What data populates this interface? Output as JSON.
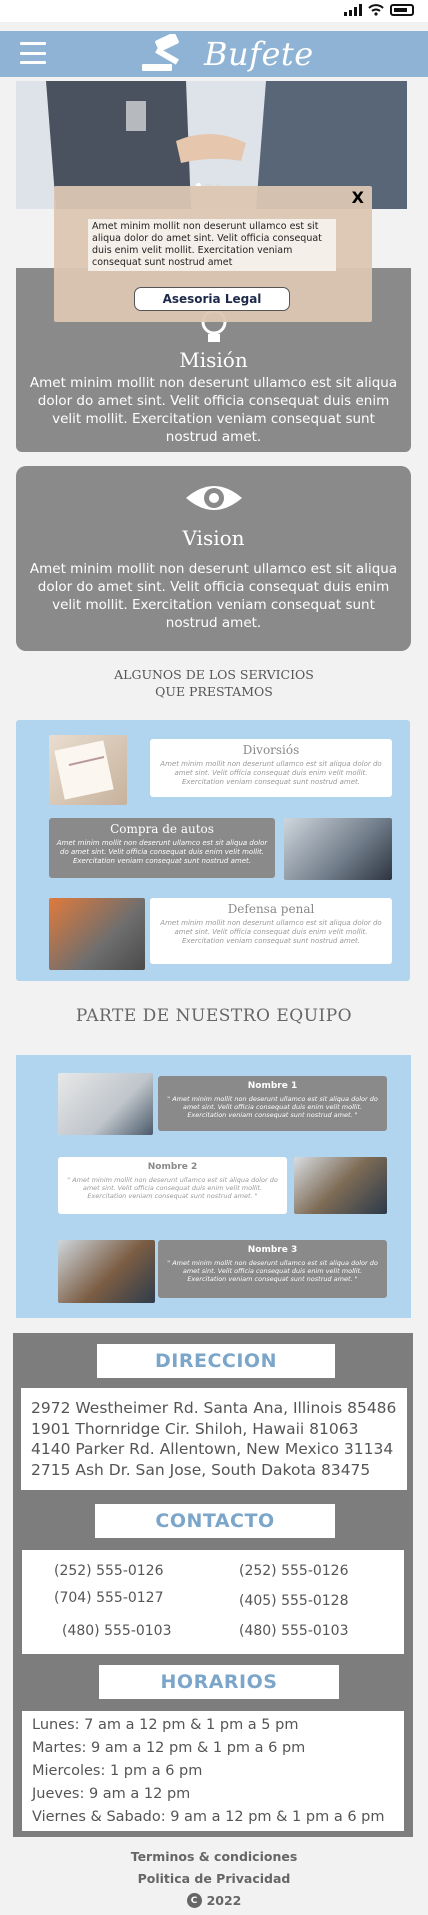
{
  "header": {
    "brand": "Bufete",
    "menu_icon": "hamburger-icon",
    "logo_icon": "gavel-icon"
  },
  "modal": {
    "close_label": "X",
    "text": "Amet minim mollit non deserunt ullamco est sit aliqua dolor do amet sint. Velit officia consequat duis enim velit mollit. Exercitation veniam consequat sunt nostrud amet",
    "button_label": "Asesoria Legal"
  },
  "mision": {
    "title": "Misión",
    "text": "Amet minim mollit non deserunt ullamco est sit aliqua dolor do amet sint. Velit officia consequat duis enim velit mollit. Exercitation veniam consequat sunt nostrud amet."
  },
  "vision": {
    "title": "Vision",
    "text": "Amet minim mollit non deserunt ullamco est sit aliqua dolor do amet sint. Velit officia consequat duis enim velit mollit. Exercitation veniam consequat sunt nostrud amet.",
    "icon": "eye-icon"
  },
  "services": {
    "title_line1": "ALGUNOS DE LOS SERVICIOS",
    "title_line2": "QUE PRESTAMOS",
    "items": [
      {
        "title": "Divorsiós",
        "text": "Amet minim mollit non deserunt ullamco est sit aliqua dolor do amet sint. Velit officia consequat duis enim velit mollit. Exercitation veniam consequat sunt nostrud amet."
      },
      {
        "title": "Compra de autos",
        "text": "Amet minim mollit non deserunt ullamco est sit aliqua dolor do amet sint. Velit officia consequat duis enim velit mollit. Exercitation veniam consequat sunt nostrud amet."
      },
      {
        "title": "Defensa penal",
        "text": "Amet minim mollit non deserunt ullamco est sit aliqua dolor do amet sint. Velit officia consequat duis enim velit mollit. Exercitation veniam consequat sunt nostrud amet."
      }
    ]
  },
  "team": {
    "title": "PARTE DE NUESTRO EQUIPO",
    "members": [
      {
        "name": "Nombre 1",
        "text": "\" Amet minim mollit non deserunt ullamco est sit aliqua dolor do amet sint. Velit officia consequat duis enim velit mollit. Exercitation veniam consequat sunt nostrud amet. \""
      },
      {
        "name": "Nombre 2",
        "text": "\" Amet minim mollit non deserunt ullamco est sit aliqua dolor do amet sint. Velit officia consequat duis enim velit mollit. Exercitation veniam consequat sunt nostrud amet. \""
      },
      {
        "name": "Nombre 3",
        "text": "\" Amet minim mollit non deserunt ullamco est sit aliqua dolor do amet sint. Velit officia consequat duis enim velit mollit. Exercitation veniam consequat sunt nostrud amet. \""
      }
    ]
  },
  "direccion": {
    "title": "DIRECCION",
    "lines": [
      "2972 Westheimer Rd. Santa Ana, Illinois 85486",
      "1901 Thornridge Cir. Shiloh, Hawaii 81063",
      "4140 Parker Rd. Allentown, New Mexico 31134",
      "2715 Ash Dr. San Jose, South Dakota 83475"
    ]
  },
  "contacto": {
    "title": "CONTACTO",
    "phones": [
      "(252) 555-0126",
      "(252) 555-0126",
      "(704) 555-0127",
      "(405) 555-0128",
      "(480) 555-0103",
      "(480) 555-0103"
    ]
  },
  "horarios": {
    "title": "HORARIOS",
    "lines": [
      "Lunes: 7 am a 12 pm & 1 pm a 5 pm",
      "Martes: 9 am a 12 pm & 1 pm a 6 pm",
      "Miercoles: 1 pm a 6 pm",
      "Jueves: 9 am a 12 pm",
      "Viernes & Sabado: 9 am a 12 pm & 1 pm a 6 pm"
    ]
  },
  "footer": {
    "terms": "Terminos & condiciones",
    "privacy": "Politica de Privacidad",
    "copyright_symbol": "C",
    "year": "2022"
  },
  "colors": {
    "header": "#8fb3d4",
    "light_blue": "#b2d5ef",
    "gray": "#8a8a8a",
    "title_blue": "#7ba6c9"
  }
}
